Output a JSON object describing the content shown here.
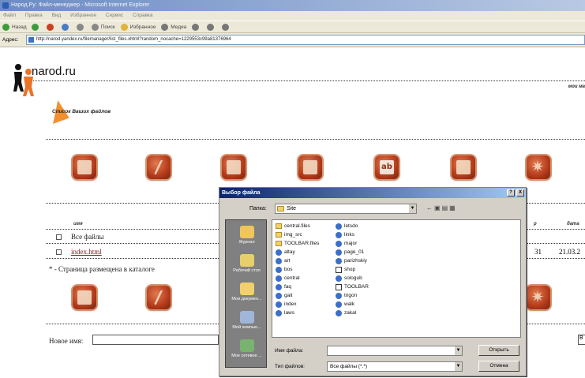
{
  "window": {
    "title": "Народ.Ру: Файл-менеджер - Microsoft Internet Explorer",
    "menu": [
      "Файл",
      "Правка",
      "Вид",
      "Избранное",
      "Сервис",
      "Справка"
    ],
    "toolbar": [
      "Назад",
      "Поиск",
      "Избранное",
      "Медиа"
    ],
    "address_label": "Адрес:",
    "address": "http://narod.yandex.ru/filemanager/list_files.xhtml?random_nocache=1229553c99a81376964"
  },
  "page": {
    "logo": "narod.ru",
    "my_link": "мои ма",
    "files_title": "Список Ваших файлов",
    "table": {
      "col_name": "имя",
      "col_size": "р",
      "col_date": "дата",
      "rows": [
        {
          "name": "Все файлы"
        },
        {
          "name": "index.html",
          "num": "31",
          "date": "21.03.2"
        }
      ]
    },
    "catalog_note": "* - Страница размещена в каталоге",
    "new_name_label": "Новое имя:",
    "right_btn": "В"
  },
  "dialog": {
    "title": "Выбор файла",
    "title_buttons": [
      "?",
      "X"
    ],
    "lookin_label": "Папка:",
    "lookin_value": "Site",
    "places": [
      "Журнал",
      "Рабочий стол",
      "Мои докумен...",
      "Мой компью...",
      "Мое сетевое ..."
    ],
    "files_col1": [
      "central.files",
      "img_src",
      "TOOLBAR.files",
      "altay",
      "art",
      "bos",
      "central",
      "faq",
      "gait",
      "index",
      "laws"
    ],
    "files_col2": [
      "letsdo",
      "links",
      "major",
      "page_01",
      "parizhskiy",
      "shop",
      "sologub",
      "TOOLBAR",
      "trigon",
      "walk",
      "zakal"
    ],
    "filename_label": "Имя файла:",
    "filename_value": "",
    "filetype_label": "Тип файлов:",
    "filetype_value": "Все файлы (*.*)",
    "open_button": "Открыть",
    "cancel_button": "Отмена"
  }
}
